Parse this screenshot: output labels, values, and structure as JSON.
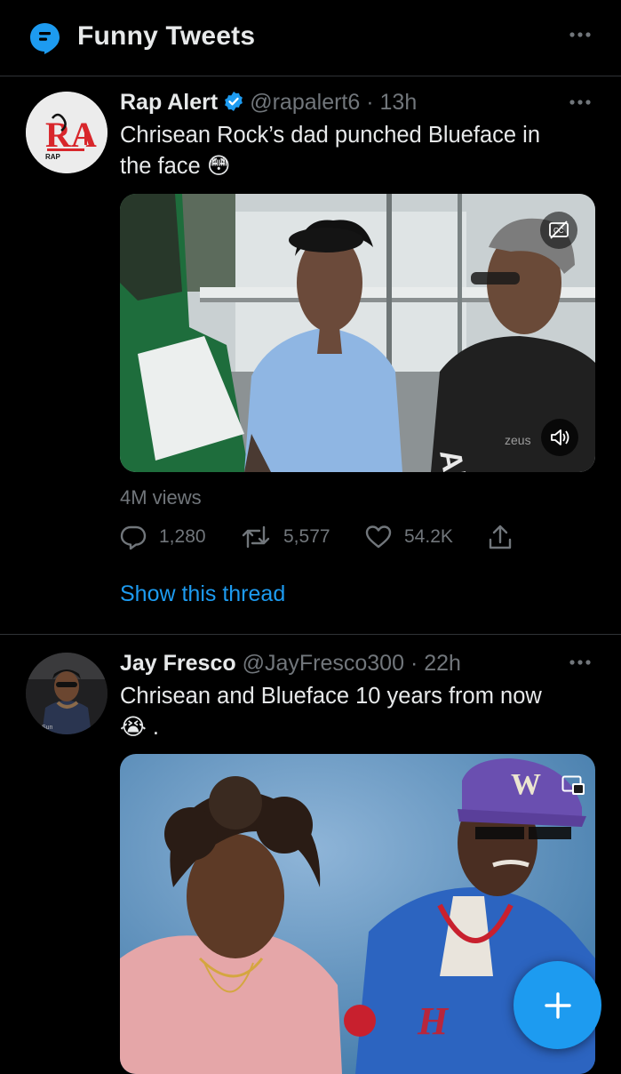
{
  "header": {
    "title": "Funny Tweets",
    "topic_icon": "topic-icon",
    "more_icon": "more-icon"
  },
  "tweets": [
    {
      "name": "Rap Alert",
      "verified": true,
      "handle": "@rapalert6",
      "dot": "·",
      "time": "13h",
      "text_line1": "Chrisean Rock’s dad punched Blueface in",
      "text_line2": "the face 😳",
      "avatar_logo_text": "RA",
      "avatar_small_text": "RAP",
      "media": {
        "type": "video",
        "watermark": "zeus",
        "shirt_text": "Al",
        "icons": [
          "captions-off-icon",
          "speaker-icon"
        ]
      },
      "views": "4M views",
      "replies": "1,280",
      "retweets": "5,577",
      "likes": "54.2K",
      "thread_link": "Show this thread"
    },
    {
      "name": "Jay Fresco",
      "verified": false,
      "handle": "@JayFresco300",
      "dot": "·",
      "time": "22h",
      "text_line1": "Chrisean and Blueface 10 years from now",
      "text_line2": "😭 .",
      "avatar_caption": "Sun",
      "media": {
        "type": "video",
        "cap_letter": "W",
        "icons": [
          "pip-icon"
        ]
      }
    }
  ],
  "fab": {
    "icon": "plus-icon",
    "label": "+"
  },
  "colors": {
    "background": "#000000",
    "text": "#e7e9ea",
    "secondary": "#71767b",
    "accent": "#1d9bf0",
    "divider": "#2f3336"
  }
}
